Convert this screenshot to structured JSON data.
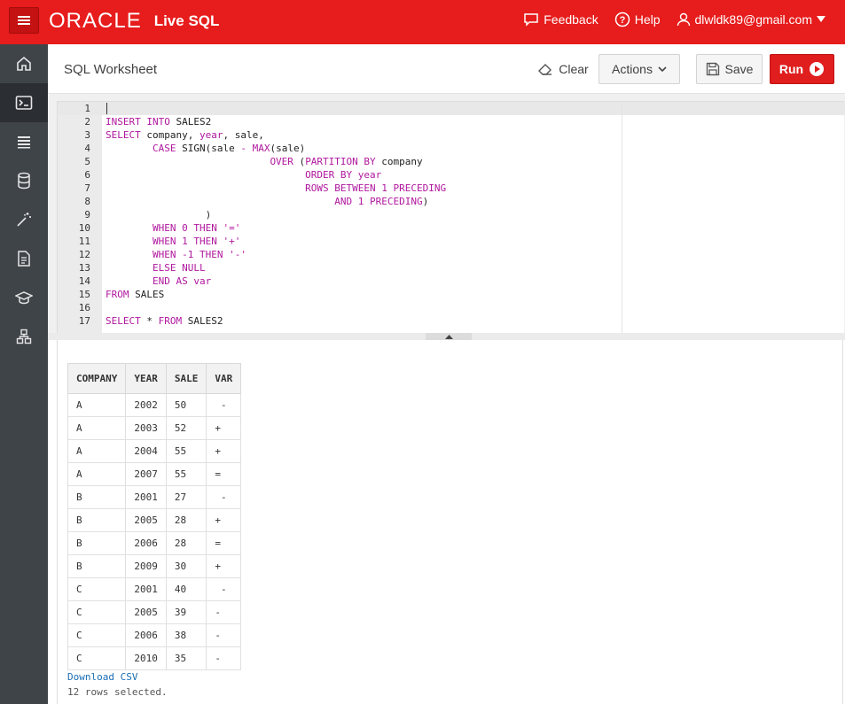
{
  "header": {
    "brand": "ORACLE",
    "product": "Live SQL",
    "feedback": "Feedback",
    "help": "Help",
    "user": "dlwldk89@gmail.com"
  },
  "sidebar": {
    "items": [
      {
        "icon": "home-icon",
        "active": false
      },
      {
        "icon": "sql-worksheet-icon",
        "active": true
      },
      {
        "icon": "list-icon",
        "active": false
      },
      {
        "icon": "database-icon",
        "active": false
      },
      {
        "icon": "magic-wand-icon",
        "active": false
      },
      {
        "icon": "document-icon",
        "active": false
      },
      {
        "icon": "graduation-cap-icon",
        "active": false
      },
      {
        "icon": "sitemap-icon",
        "active": false
      }
    ]
  },
  "toolbar": {
    "title": "SQL Worksheet",
    "clear": "Clear",
    "actions": "Actions",
    "save": "Save",
    "run": "Run"
  },
  "editor": {
    "line_numbers": [
      "1",
      "2",
      "3",
      "4",
      "5",
      "6",
      "7",
      "8",
      "9",
      "10",
      "11",
      "12",
      "13",
      "14",
      "15",
      "16",
      "17"
    ]
  },
  "results": {
    "columns": [
      "COMPANY",
      "YEAR",
      "SALE",
      "VAR"
    ],
    "rows": [
      [
        "A",
        "2002",
        "50",
        " -"
      ],
      [
        "A",
        "2003",
        "52",
        "+"
      ],
      [
        "A",
        "2004",
        "55",
        "+"
      ],
      [
        "A",
        "2007",
        "55",
        "="
      ],
      [
        "B",
        "2001",
        "27",
        " -"
      ],
      [
        "B",
        "2005",
        "28",
        "+"
      ],
      [
        "B",
        "2006",
        "28",
        "="
      ],
      [
        "B",
        "2009",
        "30",
        "+"
      ],
      [
        "C",
        "2001",
        "40",
        " -"
      ],
      [
        "C",
        "2005",
        "39",
        "-"
      ],
      [
        "C",
        "2006",
        "38",
        "-"
      ],
      [
        "C",
        "2010",
        "35",
        "-"
      ]
    ],
    "download": "Download CSV",
    "status": "12 rows selected."
  },
  "colors": {
    "brand_red": "#e71c1c",
    "sidebar": "#3f4449",
    "keyword": "#b0179e"
  }
}
